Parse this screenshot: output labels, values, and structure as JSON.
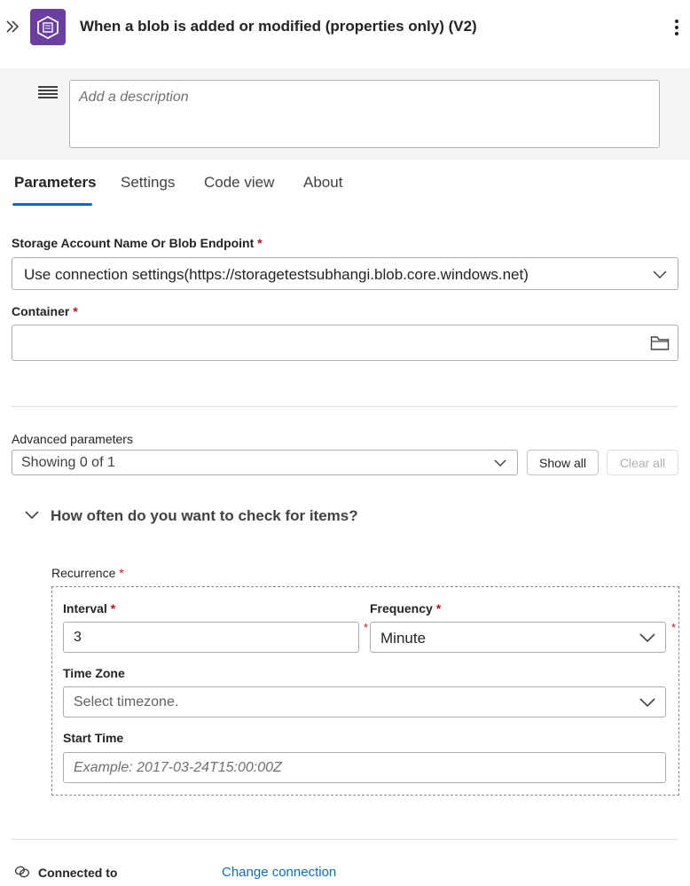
{
  "header": {
    "title": "When a blob is added or modified (properties only) (V2)",
    "icons": {
      "expand": "double-chevron-right-icon",
      "app": "azure-blob-storage-icon",
      "more": "more-vertical-icon"
    }
  },
  "description": {
    "placeholder": "Add a description",
    "icon": "text-lines-icon"
  },
  "tabs": [
    {
      "label": "Parameters",
      "active": true
    },
    {
      "label": "Settings",
      "active": false
    },
    {
      "label": "Code view",
      "active": false
    },
    {
      "label": "About",
      "active": false
    }
  ],
  "storage_account": {
    "label": "Storage Account Name Or Blob Endpoint",
    "required_mark": "*",
    "value": "Use connection settings(https://storagetestsubhangi.blob.core.windows.net)"
  },
  "container": {
    "label": "Container",
    "required_mark": "*",
    "value": "",
    "icon": "folder-icon"
  },
  "advanced": {
    "label": "Advanced parameters",
    "value": "Showing 0 of 1",
    "show_all": "Show all",
    "clear_all": "Clear all"
  },
  "section": {
    "title": "How often do you want to check for items?",
    "icon": "chevron-down-icon"
  },
  "recurrence": {
    "label": "Recurrence",
    "required_mark": "*",
    "interval": {
      "label": "Interval",
      "value": "3"
    },
    "frequency": {
      "label": "Frequency",
      "value": "Minute"
    },
    "time_zone": {
      "label": "Time Zone",
      "placeholder": "Select timezone."
    },
    "start_time": {
      "label": "Start Time",
      "placeholder": "Example: 2017-03-24T15:00:00Z"
    }
  },
  "footer": {
    "connected_label": "Connected to",
    "change_connection": "Change connection",
    "icon": "link-icon"
  },
  "colors": {
    "accent": "#0f6cbd",
    "app_icon": "#6b3fa0",
    "required": "#c50f1f"
  }
}
